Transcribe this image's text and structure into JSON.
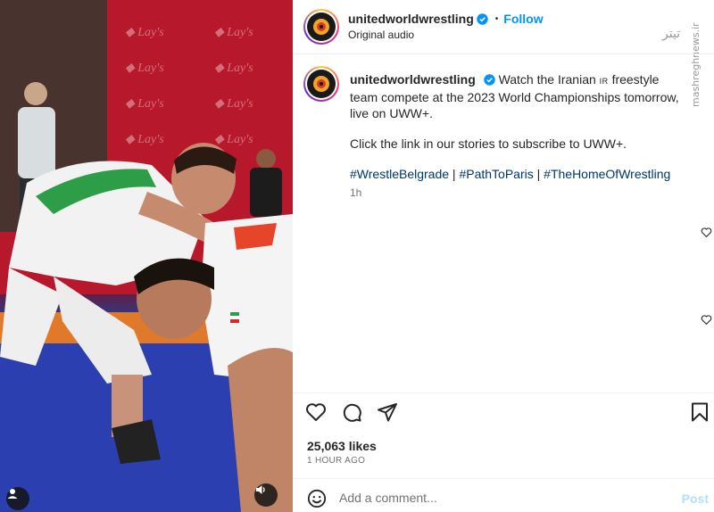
{
  "account": {
    "username": "unitedworldwrestling",
    "follow_label": "Follow",
    "audio_label": "Original audio",
    "separator": "•"
  },
  "caption": {
    "username": "unitedworldwrestling",
    "text_part1": "Watch the Iranian",
    "flag_text": "IR",
    "text_part2": "freestyle team compete at the 2023 World Championships tomorrow, live on UWW+.",
    "paragraph2": "Click the link in our stories to subscribe to UWW+.",
    "hashtags": [
      "#WrestleBelgrade",
      "#PathToParis",
      "#TheHomeOfWrestling"
    ],
    "hashtag_separator": "|",
    "time": "1h"
  },
  "engagement": {
    "likes": "25,063 likes",
    "posted_ago": "1 HOUR AGO"
  },
  "comment": {
    "placeholder": "Add a comment...",
    "post_label": "Post"
  },
  "watermark": {
    "persian": "تیتر",
    "url": "mashreghnews.ir"
  },
  "colors": {
    "accent": "#0095f6",
    "hashtag": "#00376b",
    "muted": "#737373",
    "text": "#262626"
  },
  "icons": [
    "heart-icon",
    "comment-icon",
    "share-icon",
    "bookmark-icon",
    "emoji-icon",
    "verified-icon",
    "user-icon",
    "speaker-icon"
  ]
}
